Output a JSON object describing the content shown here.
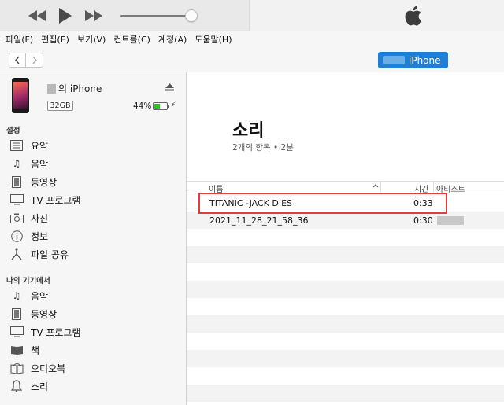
{
  "window": {
    "colors": {
      "accent": "#1f7fd6",
      "highlight": "#e53b3b",
      "battery": "#2fbf2f"
    }
  },
  "player": {
    "icons": [
      "rewind-icon",
      "play-icon",
      "fast-forward-icon",
      "apple-logo-icon"
    ],
    "volume_fraction": 0.88
  },
  "menu": {
    "items": [
      "파일(F)",
      "편집(E)",
      "보기(V)",
      "컨트롤(C)",
      "계정(A)",
      "도움말(H)"
    ]
  },
  "nav": {
    "device_button_label": "iPhone"
  },
  "device": {
    "name": "의 iPhone",
    "capacity": "32GB",
    "battery_percent": "44%",
    "battery_level": 0.44
  },
  "sidebar": {
    "settings_header": "설정",
    "settings_items": [
      {
        "label": "요약",
        "icon": "summary-icon"
      },
      {
        "label": "음악",
        "icon": "music-note-icon"
      },
      {
        "label": "동영상",
        "icon": "film-icon"
      },
      {
        "label": "TV 프로그램",
        "icon": "tv-icon"
      },
      {
        "label": "사진",
        "icon": "camera-icon"
      },
      {
        "label": "정보",
        "icon": "info-icon"
      },
      {
        "label": "파일 공유",
        "icon": "file-sharing-icon"
      }
    ],
    "ondevice_header": "나의 기기에서",
    "ondevice_items": [
      {
        "label": "음악",
        "icon": "music-note-icon"
      },
      {
        "label": "동영상",
        "icon": "film-icon"
      },
      {
        "label": "TV 프로그램",
        "icon": "tv-icon"
      },
      {
        "label": "책",
        "icon": "book-icon"
      },
      {
        "label": "오디오북",
        "icon": "audiobook-icon"
      },
      {
        "label": "소리",
        "icon": "bell-icon"
      }
    ]
  },
  "main": {
    "title": "소리",
    "subtitle": "2개의 항목 • 2분",
    "columns": {
      "name": "이름",
      "time": "시간",
      "artist": "아티스트"
    },
    "rows": [
      {
        "name": "TITANIC -JACK DIES",
        "time": "0:33",
        "artist": ""
      },
      {
        "name": "2021_11_28_21_58_36",
        "time": "0:30",
        "artist": ""
      }
    ]
  }
}
